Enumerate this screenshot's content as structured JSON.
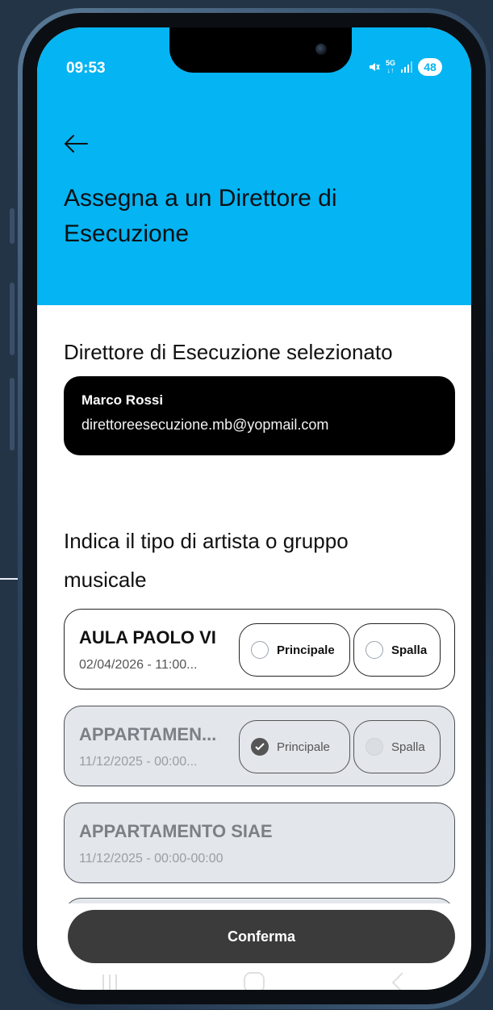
{
  "status_bar": {
    "time": "09:53",
    "network": "5G",
    "battery": "48",
    "icons": [
      "mute-icon",
      "network-icon",
      "signal-icon",
      "battery-icon"
    ]
  },
  "header": {
    "back_icon": "arrow-left-icon",
    "title": "Assegna a un Direttore di Esecuzione"
  },
  "selected_director": {
    "section_title": "Direttore di Esecuzione selezionato",
    "name": "Marco Rossi",
    "email": "direttoreesecuzione.mb@yopmail.com"
  },
  "artist_type": {
    "section_title": "Indica il tipo di artista o gruppo musicale",
    "options": {
      "principale": "Principale",
      "spalla": "Spalla"
    },
    "items": [
      {
        "name": "AULA PAOLO VI",
        "date": "02/04/2026 - 11:00...",
        "selected": "none",
        "disabled": false
      },
      {
        "name": "APPARTAMEN...",
        "date": "11/12/2025 - 00:00...",
        "selected": "principale",
        "disabled": true
      },
      {
        "name": "APPARTAMENTO SIAE",
        "date": "11/12/2025 - 00:00-00:00",
        "selected": "none",
        "disabled": true
      }
    ]
  },
  "actions": {
    "confirm": "Conferma"
  },
  "colors": {
    "header": "#05b4f2",
    "card_dark": "#000000",
    "button": "#3b3b3b",
    "disabled_bg": "#e3e6ea"
  }
}
